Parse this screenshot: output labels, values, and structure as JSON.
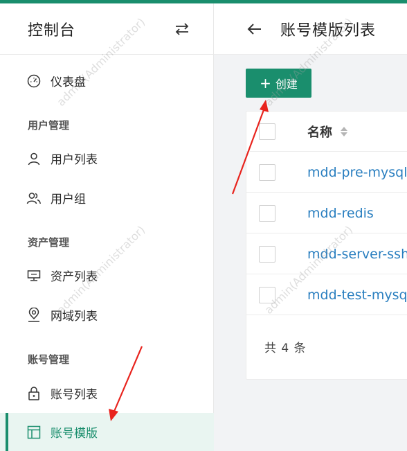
{
  "sidebar": {
    "title": "控制台",
    "items": [
      {
        "label": "仪表盘"
      },
      {
        "label": "用户列表"
      },
      {
        "label": "用户组"
      },
      {
        "label": "资产列表"
      },
      {
        "label": "网域列表"
      },
      {
        "label": "账号列表"
      },
      {
        "label": "账号模版"
      }
    ],
    "groups": [
      "用户管理",
      "资产管理",
      "账号管理"
    ]
  },
  "header": {
    "title": "账号模版列表"
  },
  "toolbar": {
    "create_label": "创建"
  },
  "table": {
    "column_name": "名称",
    "rows": [
      {
        "name": "mdd-pre-mysql-"
      },
      {
        "name": "mdd-redis"
      },
      {
        "name": "mdd-server-sshk"
      },
      {
        "name": "mdd-test-mysql-"
      }
    ],
    "total": "共 4 条"
  },
  "watermark": "admin(Administrator)",
  "colors": {
    "accent": "#1a8e6d",
    "link": "#2a7fc0",
    "annotation": "#e8231d"
  }
}
